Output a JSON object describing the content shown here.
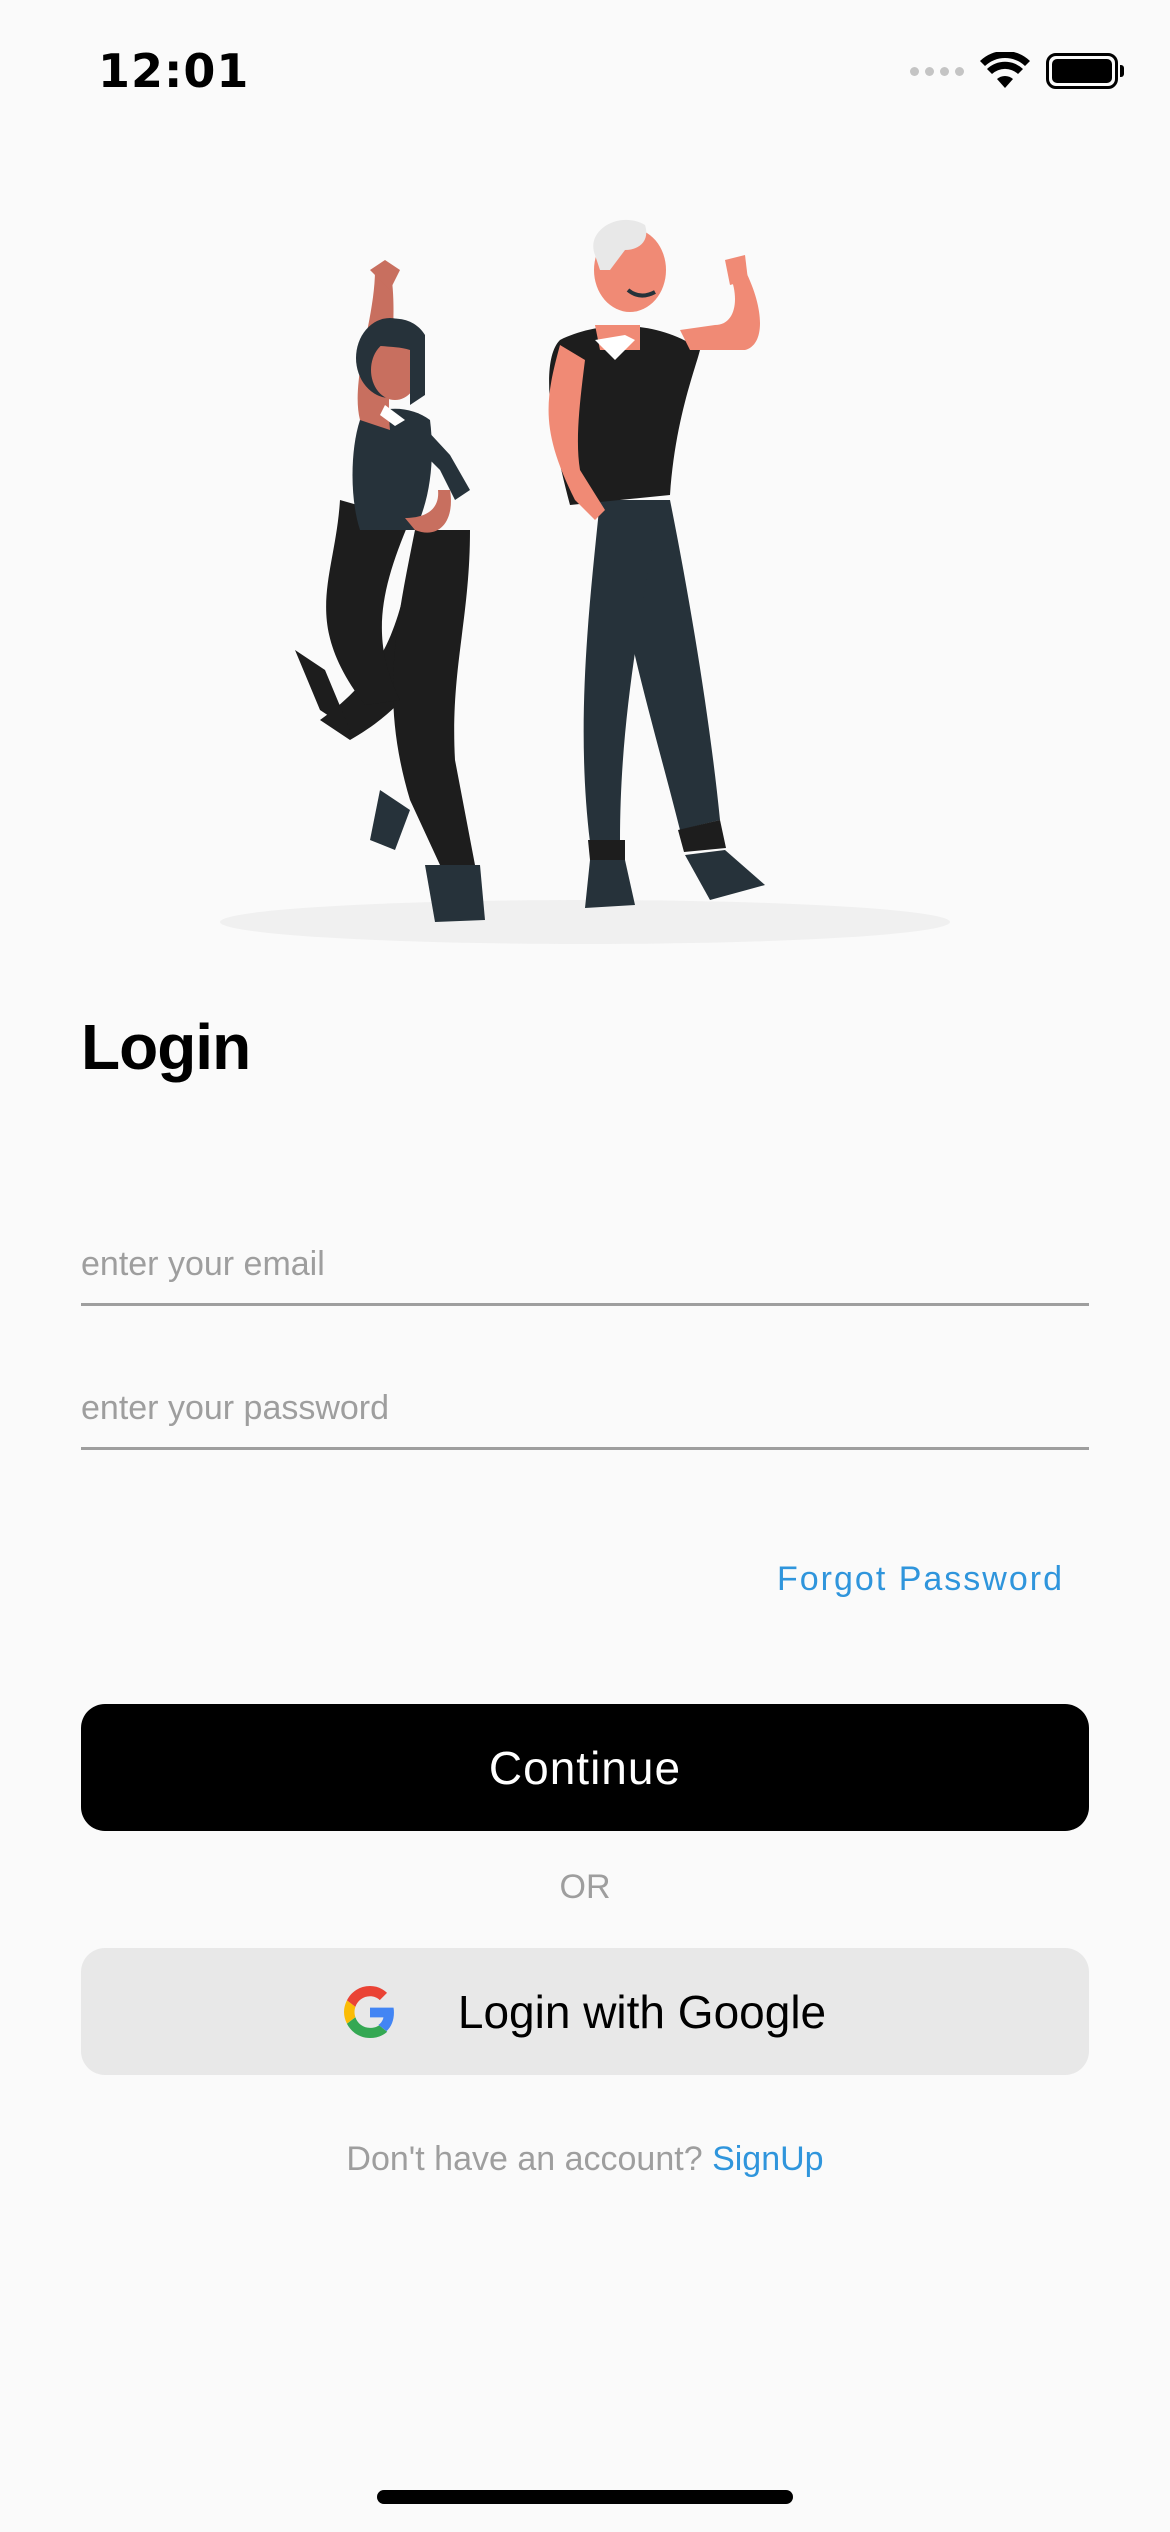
{
  "status_bar": {
    "time": "12:01"
  },
  "login": {
    "title": "Login",
    "email_placeholder": "enter your email",
    "password_placeholder": "enter your password",
    "forgot_password": "Forgot Password",
    "continue_label": "Continue",
    "or_text": "OR",
    "google_label": "Login with Google",
    "signup_prompt": "Don't have an account?",
    "signup_link": "SignUp"
  },
  "icons": {
    "signal": "cellular-signal-icon",
    "wifi": "wifi-icon",
    "battery": "battery-icon",
    "google": "google-g-icon"
  },
  "colors": {
    "background": "#fafafa",
    "primary_button": "#000000",
    "secondary_button": "#e8e8e8",
    "link": "#2f95dc",
    "muted_text": "#9e9e9e"
  }
}
